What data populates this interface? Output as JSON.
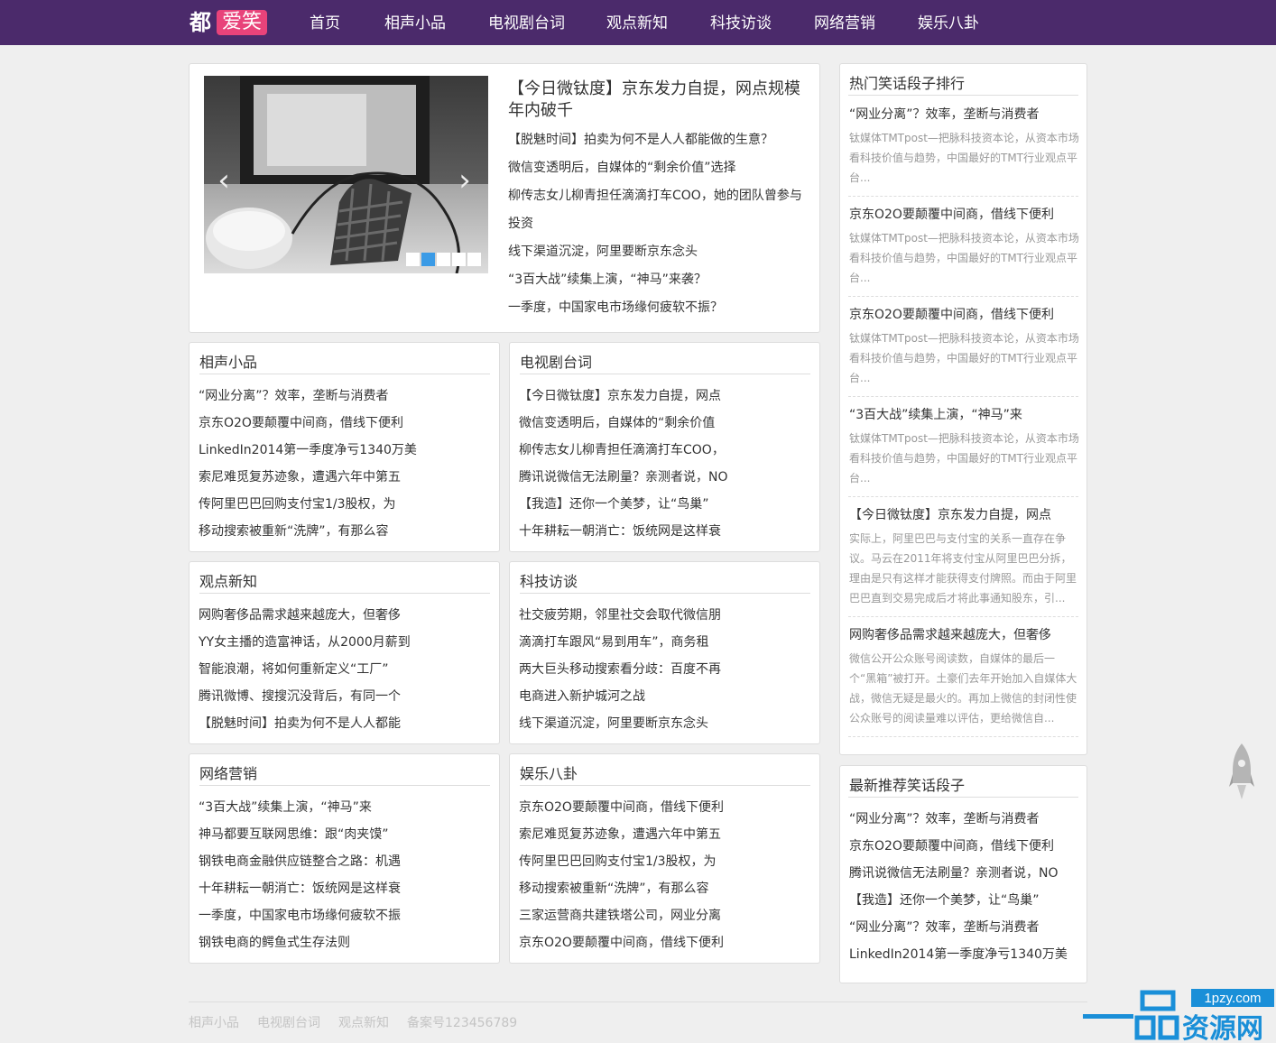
{
  "logo": {
    "part1": "都",
    "part2": "爱笑"
  },
  "nav": [
    "首页",
    "相声小品",
    "电视剧台词",
    "观点新知",
    "科技访谈",
    "网络营销",
    "娱乐八卦"
  ],
  "featured": {
    "title": "【今日微钛度】京东发力自提，网点规模年内破千",
    "links": [
      "【脱魅时间】拍卖为何不是人人都能做的生意？",
      "微信变透明后，自媒体的“剩余价值”选择",
      "柳传志女儿柳青担任滴滴打车COO，她的团队曾参与",
      "投资",
      "线下渠道沉淀，阿里要断京东念头",
      "“3百大战”续集上演，“神马”来袭？",
      "一季度，中国家电市场缘何疲软不振？"
    ],
    "slider_arrows": {
      "prev": "‹",
      "next": "›"
    },
    "slider_dots": 5,
    "active_dot": 2
  },
  "sections": [
    {
      "title": "相声小品",
      "items": [
        "“网业分离”？效率，垄断与消费者",
        "京东O2O要颠覆中间商，借线下便利",
        "LinkedIn2014第一季度净亏1340万美",
        "索尼难觅复苏迹象，遭遇六年中第五",
        "传阿里巴巴回购支付宝1/3股权，为",
        "移动搜索被重新“洗牌”，有那么容"
      ]
    },
    {
      "title": "电视剧台词",
      "items": [
        "【今日微钛度】京东发力自提，网点",
        "微信变透明后，自媒体的“剩余价值",
        "柳传志女儿柳青担任滴滴打车COO，",
        "腾讯说微信无法刷量？亲测者说，NO",
        "【我造】还你一个美梦，让“鸟巢”",
        "十年耕耘一朝消亡：饭统网是这样衰"
      ]
    },
    {
      "title": "观点新知",
      "items": [
        "网购奢侈品需求越来越庞大，但奢侈",
        "YY女主播的造富神话，从2000月薪到",
        "智能浪潮，将如何重新定义“工厂”",
        "腾讯微博、搜搜沉没背后，有同一个",
        "【脱魅时间】拍卖为何不是人人都能"
      ]
    },
    {
      "title": "科技访谈",
      "items": [
        "社交疲劳期，邻里社交会取代微信朋",
        "滴滴打车跟风“易到用车”，商务租",
        "两大巨头移动搜索看分歧：百度不再",
        "电商进入新护城河之战",
        "线下渠道沉淀，阿里要断京东念头"
      ]
    },
    {
      "title": "网络营销",
      "items": [
        "“3百大战”续集上演，“神马”来",
        "神马都要互联网思维：跟“肉夹馍”",
        "钢铁电商金融供应链整合之路：机遇",
        "十年耕耘一朝消亡：饭统网是这样衰",
        "一季度，中国家电市场缘何疲软不振",
        "钢铁电商的鳄鱼式生存法则"
      ]
    },
    {
      "title": "娱乐八卦",
      "items": [
        "京东O2O要颠覆中间商，借线下便利",
        "索尼难觅复苏迹象，遭遇六年中第五",
        "传阿里巴巴回购支付宝1/3股权，为",
        "移动搜索被重新“洗牌”，有那么容",
        "三家运营商共建铁塔公司，网业分离",
        "京东O2O要颠覆中间商，借线下便利"
      ]
    }
  ],
  "hot": {
    "title": "热门笑话段子排行",
    "items": [
      {
        "title": "“网业分离”？效率，垄断与消费者",
        "desc": "钛媒体TMTpost—把脉科技资本论，从资本市场看科技价值与趋势，中国最好的TMT行业观点平台..."
      },
      {
        "title": "京东O2O要颠覆中间商，借线下便利",
        "desc": "钛媒体TMTpost—把脉科技资本论，从资本市场看科技价值与趋势，中国最好的TMT行业观点平台..."
      },
      {
        "title": "京东O2O要颠覆中间商，借线下便利",
        "desc": "钛媒体TMTpost—把脉科技资本论，从资本市场看科技价值与趋势，中国最好的TMT行业观点平台..."
      },
      {
        "title": "“3百大战”续集上演，“神马”来",
        "desc": "钛媒体TMTpost—把脉科技资本论，从资本市场看科技价值与趋势，中国最好的TMT行业观点平台..."
      },
      {
        "title": "【今日微钛度】京东发力自提，网点",
        "desc": "实际上，阿里巴巴与支付宝的关系一直存在争议。马云在2011年将支付宝从阿里巴巴分拆，理由是只有这样才能获得支付牌照。而由于阿里巴巴直到交易完成后才将此事通知股东，引..."
      },
      {
        "title": "网购奢侈品需求越来越庞大，但奢侈",
        "desc": "微信公开公众账号阅读数，自媒体的最后一个“黑箱”被打开。土豪们去年开始加入自媒体大战，微信无疑是最火的。再加上微信的封闭性使公众账号的阅读量难以评估，更给微信自..."
      }
    ]
  },
  "latest": {
    "title": "最新推荐笑话段子",
    "items": [
      "“网业分离”？效率，垄断与消费者",
      "京东O2O要颠覆中间商，借线下便利",
      "腾讯说微信无法刷量？亲测者说，NO",
      "【我造】还你一个美梦，让“鸟巢”",
      "“网业分离”？效率，垄断与消费者",
      "LinkedIn2014第一季度净亏1340万美"
    ]
  },
  "footer": {
    "links": [
      "相声小品",
      "电视剧台词",
      "观点新知"
    ],
    "icp": "备案号123456789"
  },
  "watermark": {
    "text": "资源网",
    "url": "1pzy.com"
  },
  "colors": {
    "topbar": "#4b2a6b",
    "logo_badge": "#e8437a",
    "active_dot": "#3b9be6",
    "watermark": "#1a8fd8"
  }
}
